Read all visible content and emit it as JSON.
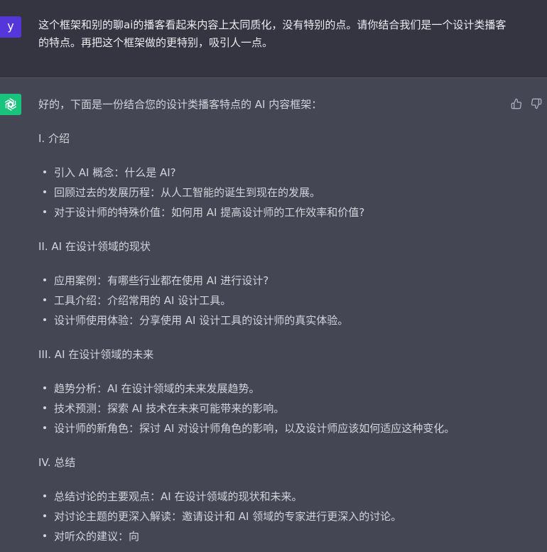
{
  "user": {
    "avatar_letter": "y",
    "message": "这个框架和别的聊ai的播客看起来内容上太同质化，没有特别的点。请你结合我们是一个设计类播客的特点。再把这个框架做的更特别，吸引人一点。"
  },
  "assistant": {
    "intro": "好的，下面是一份结合您的设计类播客特点的 AI 内容框架：",
    "sections": [
      {
        "heading": "I. 介绍",
        "items": [
          "引入 AI 概念：什么是 AI?",
          "回顾过去的发展历程：从人工智能的诞生到现在的发展。",
          "对于设计师的特殊价值：如何用 AI 提高设计师的工作效率和价值?"
        ]
      },
      {
        "heading": "II. AI 在设计领域的现状",
        "items": [
          "应用案例：有哪些行业都在使用 AI 进行设计?",
          "工具介绍：介绍常用的 AI 设计工具。",
          "设计师使用体验：分享使用 AI 设计工具的设计师的真实体验。"
        ]
      },
      {
        "heading": "III. AI 在设计领域的未来",
        "items": [
          "趋势分析：AI 在设计领域的未来发展趋势。",
          "技术预测：探索 AI 技术在未来可能带来的影响。",
          "设计师的新角色：探讨 AI 对设计师角色的影响，以及设计师应该如何适应这种变化。"
        ]
      },
      {
        "heading": "IV. 总结",
        "items": [
          "总结讨论的主要观点：AI 在设计领域的现状和未来。",
          "对讨论主题的更深入解读：邀请设计和 AI 领域的专家进行更深入的讨论。",
          "对听众的建议：向"
        ]
      }
    ]
  },
  "icons": {
    "feedback_up": "thumbs-up-icon",
    "feedback_down": "thumbs-down-icon",
    "assistant_avatar": "openai-logo-icon"
  },
  "colors": {
    "user_bg": "#343541",
    "assistant_bg": "#444654",
    "user_avatar": "#5436da",
    "assistant_avatar": "#19c37d"
  }
}
